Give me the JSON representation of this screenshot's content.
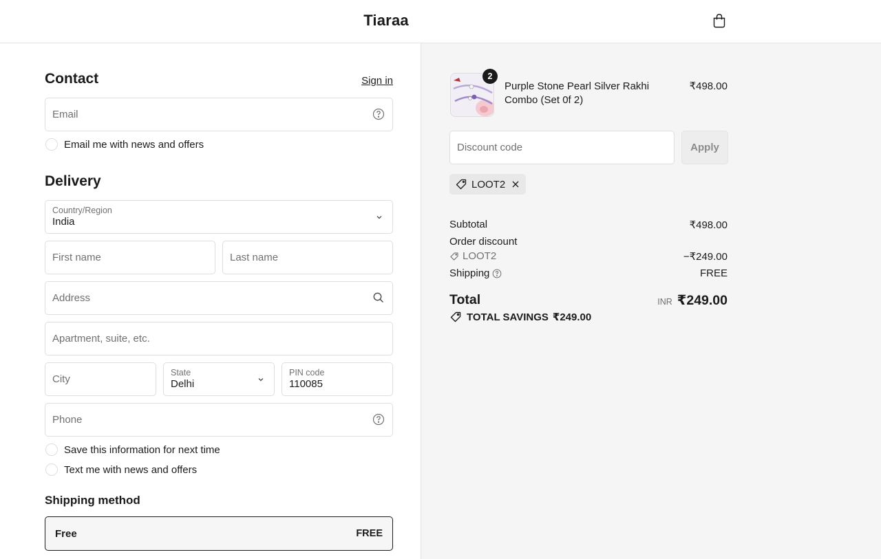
{
  "header": {
    "brand": "Tiaraa",
    "cart_icon": "shopping-bag-icon"
  },
  "contact": {
    "title": "Contact",
    "sign_in": "Sign in",
    "email_placeholder": "Email",
    "email_news_label": "Email me with news and offers"
  },
  "delivery": {
    "title": "Delivery",
    "country_label": "Country/Region",
    "country_value": "India",
    "first_name_placeholder": "First name",
    "last_name_placeholder": "Last name",
    "address_placeholder": "Address",
    "apartment_placeholder": "Apartment, suite, etc.",
    "city_placeholder": "City",
    "state_label": "State",
    "state_value": "Delhi",
    "pin_label": "PIN code",
    "pin_value": "110085",
    "phone_placeholder": "Phone",
    "save_info_label": "Save this information for next time",
    "text_news_label": "Text me with news and offers"
  },
  "shipping_method": {
    "title": "Shipping method",
    "option_name": "Free",
    "option_price": "FREE"
  },
  "summary": {
    "product": {
      "name": "Purple Stone Pearl Silver Rakhi Combo (Set 0f 2)",
      "quantity": "2",
      "price": "₹498.00"
    },
    "discount_placeholder": "Discount code",
    "apply_label": "Apply",
    "applied_code": "LOOT2",
    "subtotal_label": "Subtotal",
    "subtotal_value": "₹498.00",
    "order_discount_label": "Order discount",
    "discount_code": "LOOT2",
    "discount_value": "−₹249.00",
    "shipping_label": "Shipping",
    "shipping_value": "FREE",
    "total_label": "Total",
    "total_currency": "INR",
    "total_value": "₹249.00",
    "savings_label": "TOTAL SAVINGS",
    "savings_value": "₹249.00"
  },
  "colors": {
    "accent": "#1a1a1a",
    "summary_bg": "#f5f5f5",
    "border": "#dedede"
  }
}
